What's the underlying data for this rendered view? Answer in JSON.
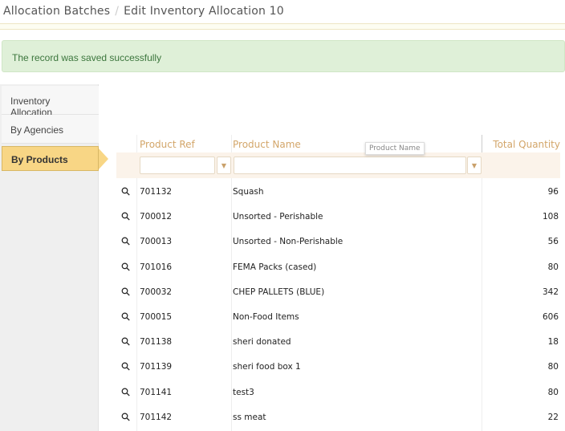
{
  "breadcrumb": {
    "parent": "Allocation Batches",
    "current": "Edit Inventory Allocation 10"
  },
  "alert": "The record was saved successfully",
  "sidebar": {
    "items": [
      {
        "label": "Inventory Allocation"
      },
      {
        "label": "By Agencies"
      },
      {
        "label": "By Products",
        "active": true
      }
    ]
  },
  "grid": {
    "columns": [
      "Product Ref",
      "Product Name",
      "Total Quantity"
    ],
    "tooltip": "Product Name",
    "rows": [
      [
        "701132",
        "Squash",
        "96"
      ],
      [
        "700012",
        "Unsorted - Perishable",
        "108"
      ],
      [
        "700013",
        "Unsorted - Non-Perishable",
        "56"
      ],
      [
        "701016",
        "FEMA Packs (cased)",
        "80"
      ],
      [
        "700032",
        "CHEP PALLETS (BLUE)",
        "342"
      ],
      [
        "700015",
        "Non-Food Items",
        "606"
      ],
      [
        "701138",
        "sheri donated",
        "18"
      ],
      [
        "701139",
        "sheri food box 1",
        "80"
      ],
      [
        "701141",
        "test3",
        "80"
      ],
      [
        "701142",
        "ss meat",
        "22"
      ]
    ]
  }
}
